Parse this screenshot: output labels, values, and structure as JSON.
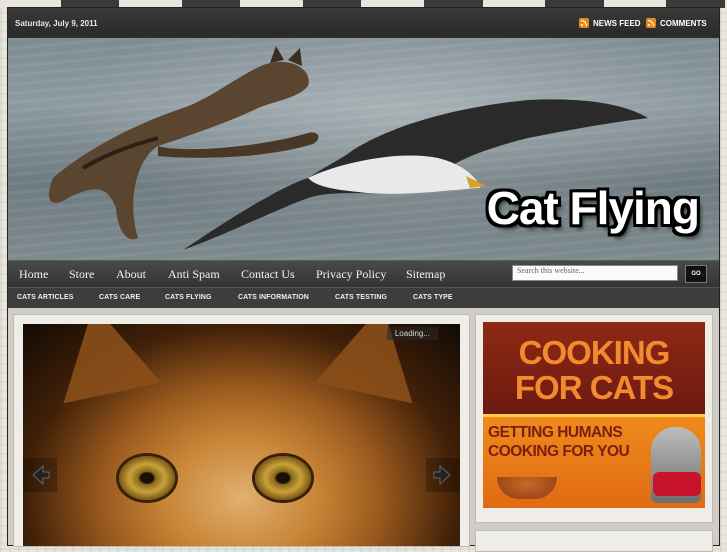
{
  "topbar": {
    "date": "Saturday, July 9, 2011",
    "news_feed": "NEWS FEED",
    "comments": "COMMENTS"
  },
  "header": {
    "site_title": "Cat Flying"
  },
  "nav": {
    "items": [
      "Home",
      "Store",
      "About",
      "Anti Spam",
      "Contact Us",
      "Privacy Policy",
      "Sitemap"
    ],
    "search_placeholder": "Search this website...",
    "search_button": "GO"
  },
  "categories": {
    "items": [
      "CATS ARTICLES",
      "CATS CARE",
      "CATS FLYING",
      "CATS INFORMATION",
      "CATS TESTING",
      "CATS TYPE"
    ]
  },
  "slider": {
    "loading": "Loading..."
  },
  "ad": {
    "line1": "COOKING",
    "line2": "FOR CATS",
    "sub1": "GETTING HUMANS",
    "sub2": "COOKING FOR YOU"
  },
  "colors": {
    "rss": "#e38b1e",
    "ad_orange": "#f28a2e",
    "ad_red": "#7a1e12"
  }
}
